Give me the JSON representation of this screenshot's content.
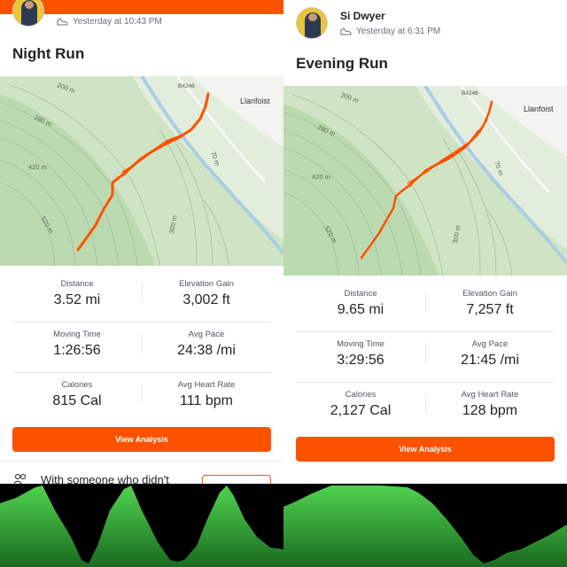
{
  "colors": {
    "accent": "#fc5200",
    "route": "#fc5200",
    "elevation_fill_top": "#4fd24f",
    "elevation_fill_bottom": "#1a6b1f"
  },
  "left": {
    "timestamp": "Yesterday at 10:43 PM",
    "title": "Night Run",
    "map": {
      "labels": {
        "c200": "200 m",
        "c280": "280 m",
        "c420": "420 m",
        "c520": "520 m",
        "c300": "300 m",
        "c70": "70 m",
        "road": "B4246",
        "town": "Llanfoist"
      }
    },
    "stats": [
      {
        "label": "Distance",
        "value": "3.52 mi"
      },
      {
        "label": "Elevation Gain",
        "value": "3,002 ft"
      },
      {
        "label": "Moving Time",
        "value": "1:26:56"
      },
      {
        "label": "Avg Pace",
        "value": "24:38 /mi"
      },
      {
        "label": "Calories",
        "value": "815 Cal"
      },
      {
        "label": "Avg Heart Rate",
        "value": "111 bpm"
      }
    ],
    "button": "View Analysis",
    "promo_text": "With someone who didn't"
  },
  "right": {
    "athlete": "Si Dwyer",
    "timestamp": "Yesterday at 6:31 PM",
    "title": "Evening Run",
    "map": {
      "labels": {
        "c200": "200 m",
        "c280": "280 m",
        "c420": "420 m",
        "c520": "520 m",
        "c300": "300 m",
        "c70": "70 m",
        "road": "B4246",
        "town": "Llanfoist"
      }
    },
    "stats": [
      {
        "label": "Distance",
        "value": "9.65 mi"
      },
      {
        "label": "Elevation Gain",
        "value": "7,257 ft"
      },
      {
        "label": "Moving Time",
        "value": "3:29:56"
      },
      {
        "label": "Avg Pace",
        "value": "21:45 /mi"
      },
      {
        "label": "Calories",
        "value": "2,127 Cal"
      },
      {
        "label": "Avg Heart Rate",
        "value": "128 bpm"
      }
    ],
    "button": "View Analysis"
  }
}
